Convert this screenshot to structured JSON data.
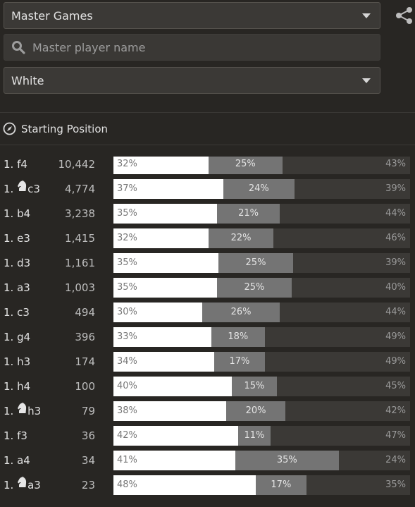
{
  "database_select": {
    "selected": "Master Games"
  },
  "player_search": {
    "placeholder": "Master player name"
  },
  "color_select": {
    "selected": "White"
  },
  "position": {
    "label": "Starting Position"
  },
  "moves": [
    {
      "num": "1.",
      "piece": "",
      "move": "f4",
      "games": "10,442",
      "white": 32,
      "draw": 25,
      "black": 43,
      "white_label": "32%",
      "draw_label": "25%",
      "black_label": "43%"
    },
    {
      "num": "1.",
      "piece": "knight",
      "move": "c3",
      "games": "4,774",
      "white": 37,
      "draw": 24,
      "black": 39,
      "white_label": "37%",
      "draw_label": "24%",
      "black_label": "39%"
    },
    {
      "num": "1.",
      "piece": "",
      "move": "b4",
      "games": "3,238",
      "white": 35,
      "draw": 21,
      "black": 44,
      "white_label": "35%",
      "draw_label": "21%",
      "black_label": "44%"
    },
    {
      "num": "1.",
      "piece": "",
      "move": "e3",
      "games": "1,415",
      "white": 32,
      "draw": 22,
      "black": 46,
      "white_label": "32%",
      "draw_label": "22%",
      "black_label": "46%"
    },
    {
      "num": "1.",
      "piece": "",
      "move": "d3",
      "games": "1,161",
      "white": 35,
      "draw": 25,
      "black": 39,
      "white_label": "35%",
      "draw_label": "25%",
      "black_label": "39%"
    },
    {
      "num": "1.",
      "piece": "",
      "move": "a3",
      "games": "1,003",
      "white": 35,
      "draw": 25,
      "black": 40,
      "white_label": "35%",
      "draw_label": "25%",
      "black_label": "40%"
    },
    {
      "num": "1.",
      "piece": "",
      "move": "c3",
      "games": "494",
      "white": 30,
      "draw": 26,
      "black": 44,
      "white_label": "30%",
      "draw_label": "26%",
      "black_label": "44%"
    },
    {
      "num": "1.",
      "piece": "",
      "move": "g4",
      "games": "396",
      "white": 33,
      "draw": 18,
      "black": 49,
      "white_label": "33%",
      "draw_label": "18%",
      "black_label": "49%"
    },
    {
      "num": "1.",
      "piece": "",
      "move": "h3",
      "games": "174",
      "white": 34,
      "draw": 17,
      "black": 49,
      "white_label": "34%",
      "draw_label": "17%",
      "black_label": "49%"
    },
    {
      "num": "1.",
      "piece": "",
      "move": "h4",
      "games": "100",
      "white": 40,
      "draw": 15,
      "black": 45,
      "white_label": "40%",
      "draw_label": "15%",
      "black_label": "45%"
    },
    {
      "num": "1.",
      "piece": "knight",
      "move": "h3",
      "games": "79",
      "white": 38,
      "draw": 20,
      "black": 42,
      "white_label": "38%",
      "draw_label": "20%",
      "black_label": "42%"
    },
    {
      "num": "1.",
      "piece": "",
      "move": "f3",
      "games": "36",
      "white": 42,
      "draw": 11,
      "black": 47,
      "white_label": "42%",
      "draw_label": "11%",
      "black_label": "47%"
    },
    {
      "num": "1.",
      "piece": "",
      "move": "a4",
      "games": "34",
      "white": 41,
      "draw": 35,
      "black": 24,
      "white_label": "41%",
      "draw_label": "35%",
      "black_label": "24%"
    },
    {
      "num": "1.",
      "piece": "knight",
      "move": "a3",
      "games": "23",
      "white": 48,
      "draw": 17,
      "black": 35,
      "white_label": "48%",
      "draw_label": "17%",
      "black_label": "35%"
    }
  ]
}
